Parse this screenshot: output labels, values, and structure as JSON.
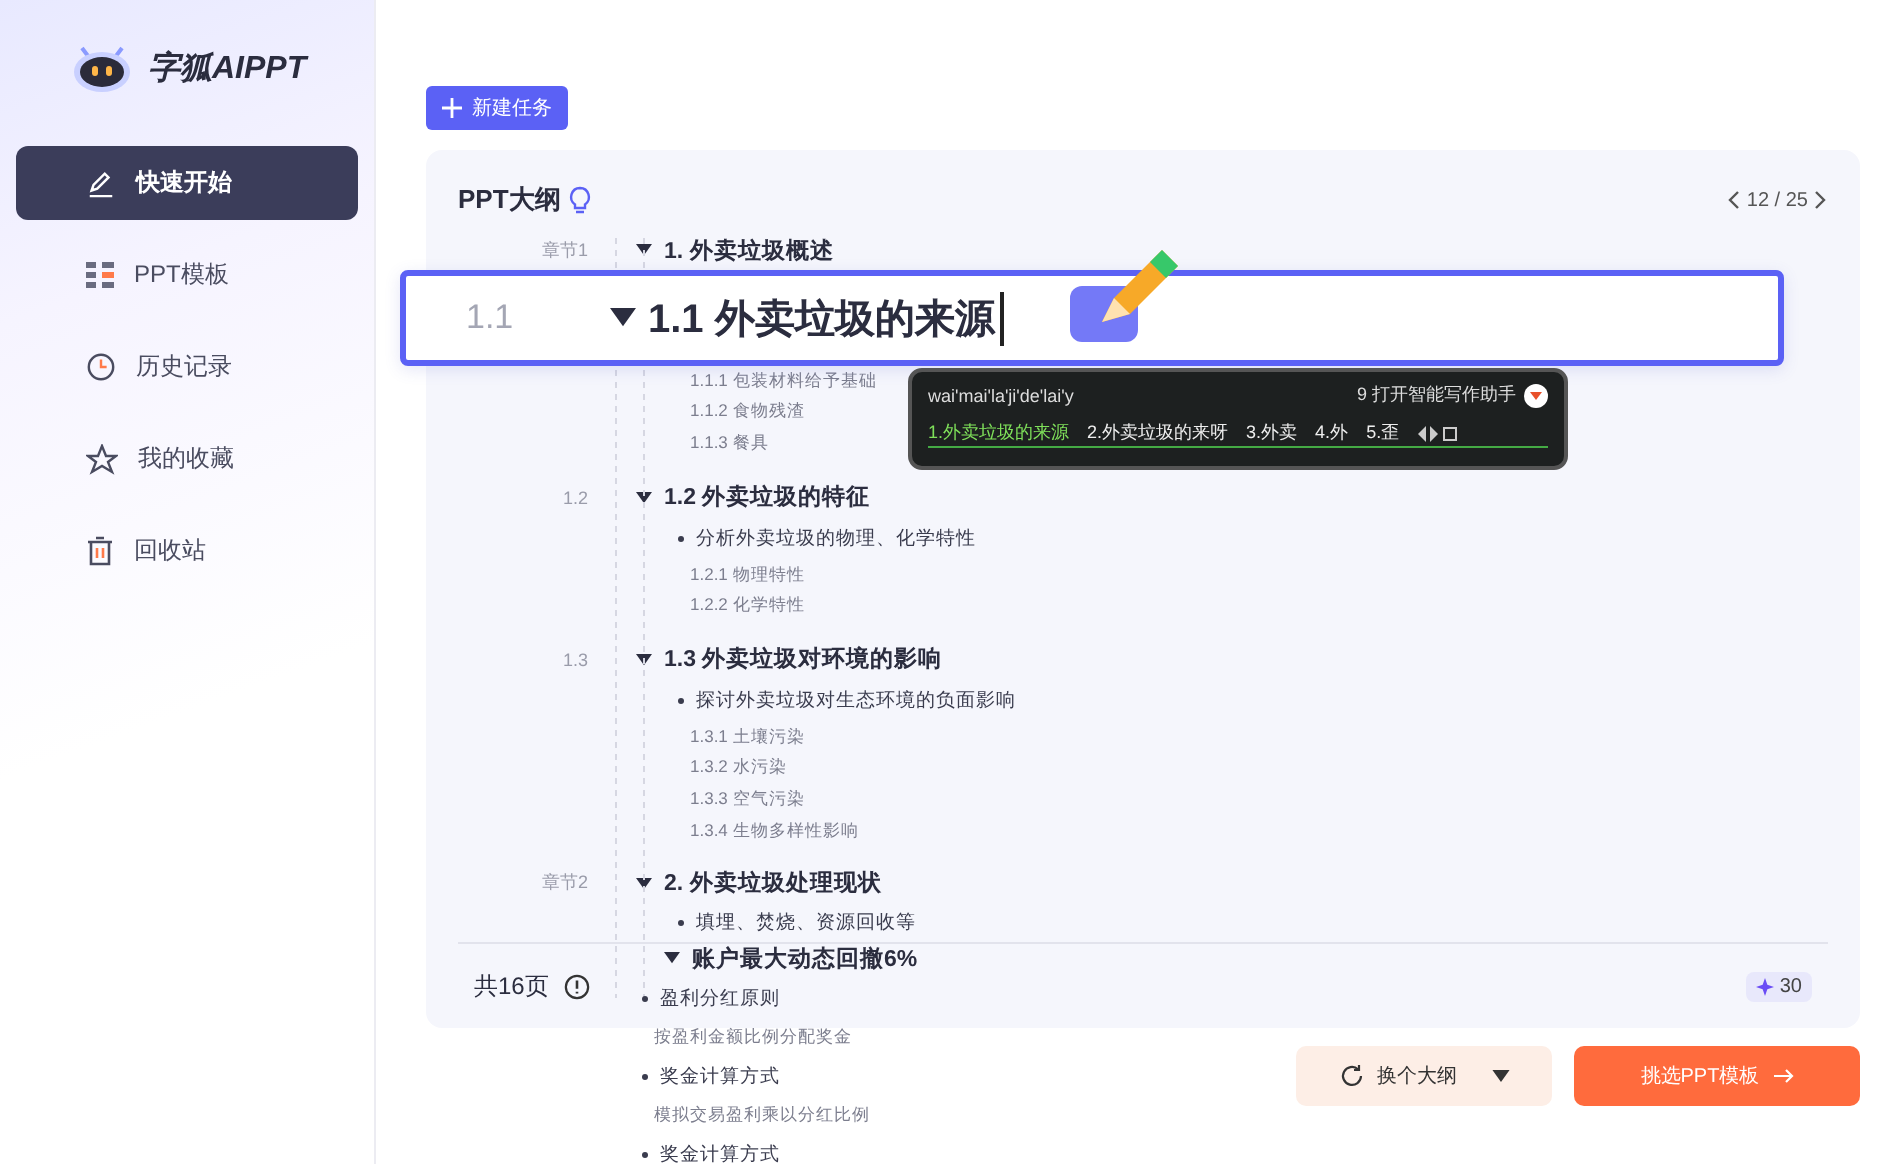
{
  "sidebar": {
    "logo_text": "字狐AIPPT",
    "items": [
      {
        "label": "快速开始",
        "selected": true
      },
      {
        "label": "PPT模板",
        "selected": false
      },
      {
        "label": "历史记录",
        "selected": false
      },
      {
        "label": "我的收藏",
        "selected": false
      },
      {
        "label": "回收站",
        "selected": false
      }
    ]
  },
  "new_task_button": "新建任务",
  "outline": {
    "title": "PPT大纲",
    "pager": "12 / 25",
    "chapters": [
      {
        "label": "章节1",
        "title": "1. 外卖垃圾概述",
        "sections": [
          {
            "number": "1.1",
            "title": "1.1 外卖垃圾的来源",
            "editing": true,
            "subitems": [
              "1.1.1 包装材料给予基础",
              "1.1.2 食物残渣",
              "1.1.3 餐具"
            ]
          },
          {
            "number": "1.2",
            "title": "1.2 外卖垃圾的特征",
            "editing": false,
            "bullets": [
              "分析外卖垃圾的物理、化学特性"
            ],
            "subitems": [
              "1.2.1 物理特性",
              "1.2.2 化学特性"
            ]
          },
          {
            "number": "1.3",
            "title": "1.3 外卖垃圾对环境的影响",
            "editing": false,
            "bullets": [
              "探讨外卖垃圾对生态环境的负面影响"
            ],
            "subitems": [
              "1.3.1 土壤污染",
              "1.3.2 水污染",
              "1.3.3 空气污染",
              "1.3.4 生物多样性影响"
            ]
          }
        ]
      },
      {
        "label": "章节2",
        "title": "2. 外卖垃圾处理现状",
        "bullets": [
          "填埋、焚烧、资源回收等"
        ]
      }
    ],
    "page_count": "共16页",
    "credits": "30"
  },
  "ime": {
    "pinyin": "wai'mai'la'ji'de'lai'y",
    "hint": "9 打开智能写作助手",
    "candidates": [
      {
        "text": "1.外卖垃圾的来源",
        "selected": true
      },
      {
        "text": "2.外卖垃圾的来呀",
        "selected": false
      },
      {
        "text": "3.外卖",
        "selected": false
      },
      {
        "text": "4.外",
        "selected": false
      },
      {
        "text": "5.歪",
        "selected": false
      }
    ]
  },
  "overflow_lines": [
    {
      "kind": "heading",
      "text": "账户最大动态回撤6%"
    },
    {
      "kind": "bullet",
      "text": "盈利分红原则"
    },
    {
      "kind": "note",
      "text": "按盈利金额比例分配奖金"
    },
    {
      "kind": "bullet",
      "text": "奖金计算方式"
    },
    {
      "kind": "note",
      "text": "模拟交易盈利乘以分红比例"
    },
    {
      "kind": "bullet",
      "text": "奖金计算方式"
    }
  ],
  "actions": {
    "change_outline": "换个大纲",
    "pick_template": "挑选PPT模板"
  }
}
